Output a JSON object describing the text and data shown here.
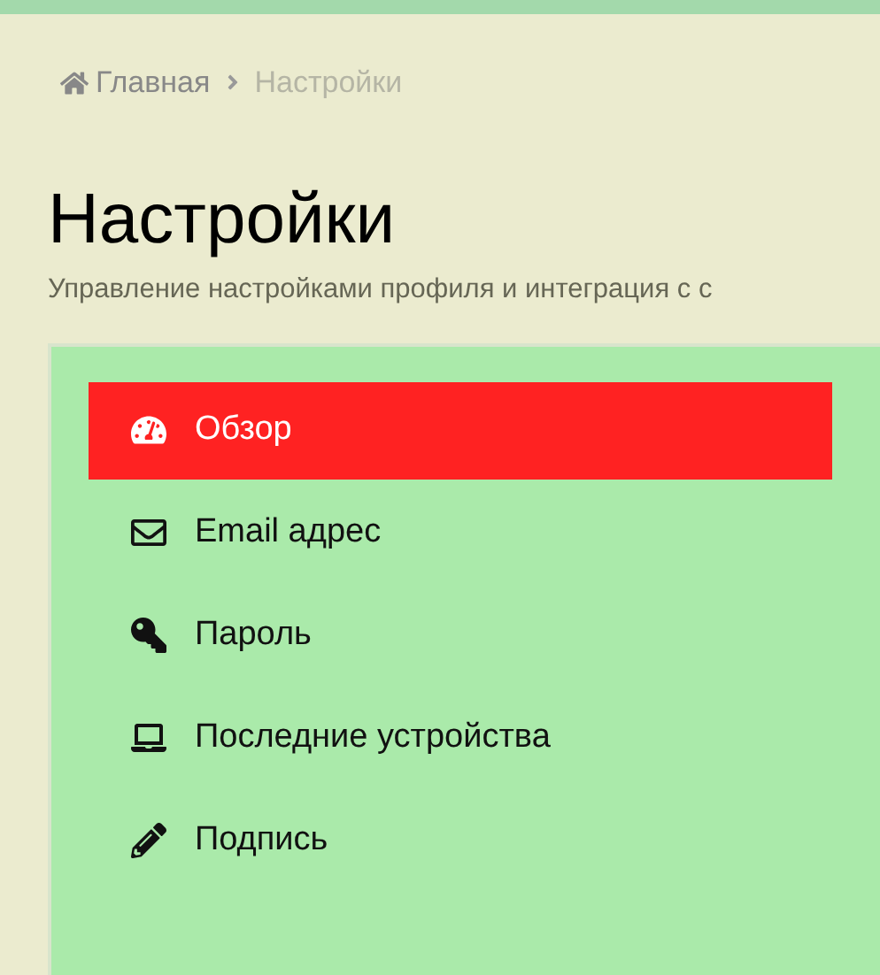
{
  "breadcrumb": [
    {
      "label": "Главная",
      "kind": "home",
      "current": false
    },
    {
      "label": "Настройки",
      "kind": "page",
      "current": true
    }
  ],
  "title": "Настройки",
  "subtitle": "Управление настройками профиля и интеграция с с",
  "menu": [
    {
      "label": "Обзор",
      "kind": "overview",
      "selected": true
    },
    {
      "label": "Email адрес",
      "kind": "email",
      "selected": false
    },
    {
      "label": "Пароль",
      "kind": "password",
      "selected": false
    },
    {
      "label": "Последние устройства",
      "kind": "devices",
      "selected": false
    },
    {
      "label": "Подпись",
      "kind": "signature",
      "selected": false
    }
  ]
}
